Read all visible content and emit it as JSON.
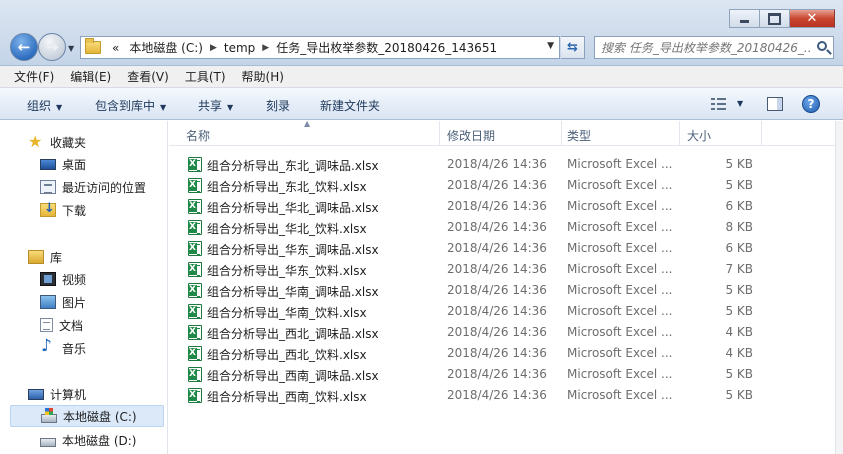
{
  "window": {
    "minimize_label": "",
    "maximize_label": "",
    "close_label": "✕"
  },
  "nav": {
    "back_icon": "back-arrow-icon",
    "forward_icon": "forward-arrow-icon"
  },
  "address": {
    "overflow": "«",
    "crumbs": [
      "本地磁盘 (C:)",
      "temp",
      "任务_导出枚举参数_20180426_143651"
    ]
  },
  "search": {
    "placeholder": "搜索 任务_导出枚举参数_20180426_..."
  },
  "menubar": {
    "items": [
      "文件(F)",
      "编辑(E)",
      "查看(V)",
      "工具(T)",
      "帮助(H)"
    ]
  },
  "toolbar": {
    "organize": "组织",
    "include_in_library": "包含到库中",
    "share": "共享",
    "burn": "刻录",
    "new_folder": "新建文件夹"
  },
  "sidebar": {
    "favorites": "收藏夹",
    "desktop": "桌面",
    "recent": "最近访问的位置",
    "downloads": "下载",
    "libraries": "库",
    "videos": "视频",
    "pictures": "图片",
    "documents": "文档",
    "music": "音乐",
    "computer": "计算机",
    "drive_c": "本地磁盘 (C:)",
    "drive_d": "本地磁盘 (D:)"
  },
  "columns": {
    "name": "名称",
    "modified": "修改日期",
    "type": "类型",
    "size": "大小"
  },
  "files": [
    {
      "name": "组合分析导出_东北_调味品.xlsx",
      "date": "2018/4/26 14:36",
      "type": "Microsoft Excel ...",
      "size": "5 KB"
    },
    {
      "name": "组合分析导出_东北_饮料.xlsx",
      "date": "2018/4/26 14:36",
      "type": "Microsoft Excel ...",
      "size": "5 KB"
    },
    {
      "name": "组合分析导出_华北_调味品.xlsx",
      "date": "2018/4/26 14:36",
      "type": "Microsoft Excel ...",
      "size": "6 KB"
    },
    {
      "name": "组合分析导出_华北_饮料.xlsx",
      "date": "2018/4/26 14:36",
      "type": "Microsoft Excel ...",
      "size": "8 KB"
    },
    {
      "name": "组合分析导出_华东_调味品.xlsx",
      "date": "2018/4/26 14:36",
      "type": "Microsoft Excel ...",
      "size": "6 KB"
    },
    {
      "name": "组合分析导出_华东_饮料.xlsx",
      "date": "2018/4/26 14:36",
      "type": "Microsoft Excel ...",
      "size": "7 KB"
    },
    {
      "name": "组合分析导出_华南_调味品.xlsx",
      "date": "2018/4/26 14:36",
      "type": "Microsoft Excel ...",
      "size": "5 KB"
    },
    {
      "name": "组合分析导出_华南_饮料.xlsx",
      "date": "2018/4/26 14:36",
      "type": "Microsoft Excel ...",
      "size": "5 KB"
    },
    {
      "name": "组合分析导出_西北_调味品.xlsx",
      "date": "2018/4/26 14:36",
      "type": "Microsoft Excel ...",
      "size": "4 KB"
    },
    {
      "name": "组合分析导出_西北_饮料.xlsx",
      "date": "2018/4/26 14:36",
      "type": "Microsoft Excel ...",
      "size": "4 KB"
    },
    {
      "name": "组合分析导出_西南_调味品.xlsx",
      "date": "2018/4/26 14:36",
      "type": "Microsoft Excel ...",
      "size": "5 KB"
    },
    {
      "name": "组合分析导出_西南_饮料.xlsx",
      "date": "2018/4/26 14:36",
      "type": "Microsoft Excel ...",
      "size": "5 KB"
    }
  ]
}
